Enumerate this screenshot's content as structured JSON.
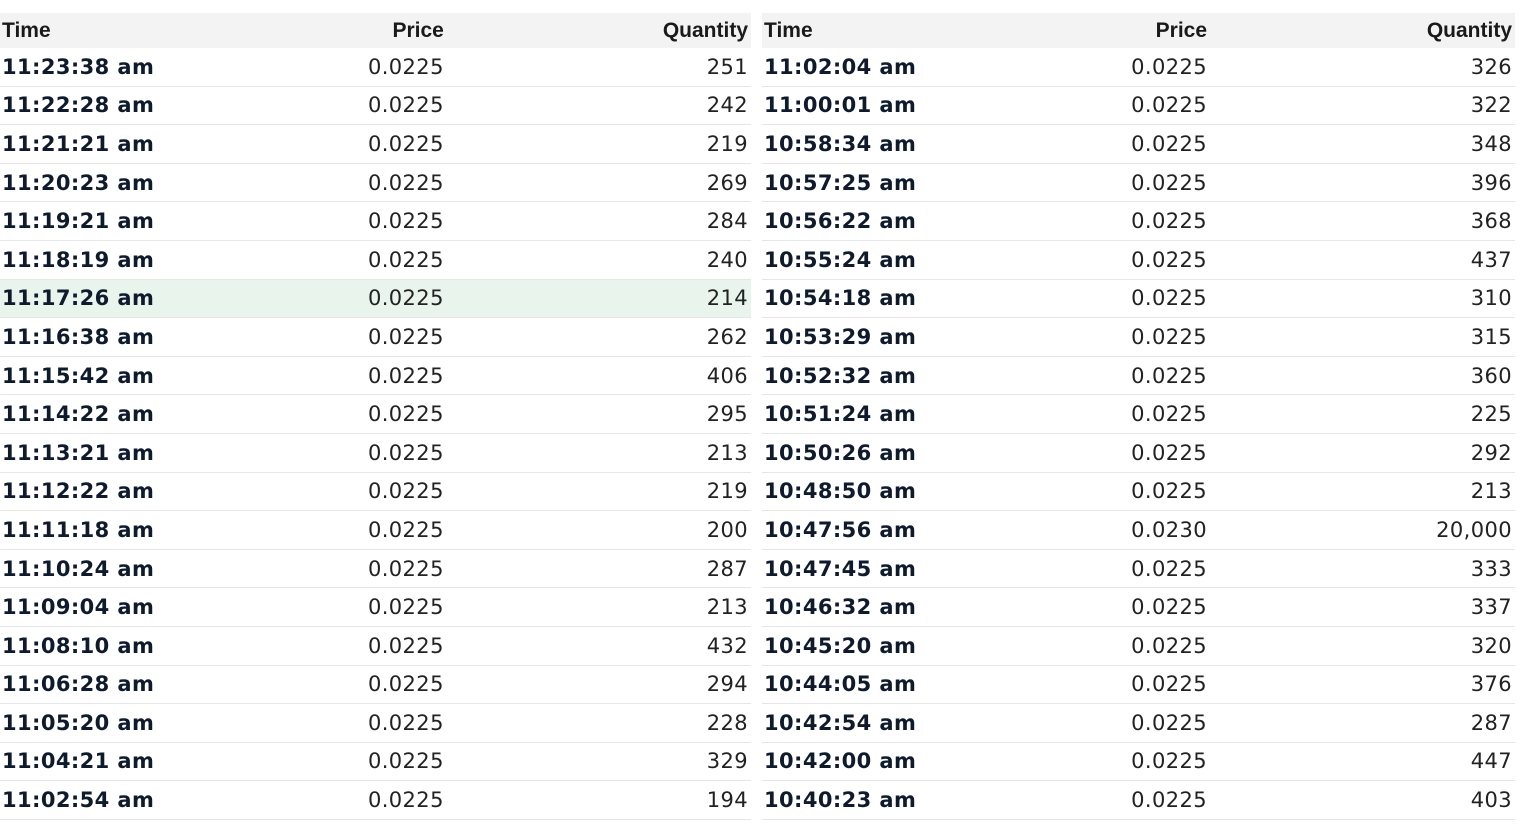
{
  "tables": [
    {
      "headers": {
        "time": "Time",
        "price": "Price",
        "quantity": "Quantity"
      },
      "rows": [
        {
          "time": "11:23:38 am",
          "price": "0.0225",
          "quantity": "251"
        },
        {
          "time": "11:22:28 am",
          "price": "0.0225",
          "quantity": "242"
        },
        {
          "time": "11:21:21 am",
          "price": "0.0225",
          "quantity": "219"
        },
        {
          "time": "11:20:23 am",
          "price": "0.0225",
          "quantity": "269"
        },
        {
          "time": "11:19:21 am",
          "price": "0.0225",
          "quantity": "284"
        },
        {
          "time": "11:18:19 am",
          "price": "0.0225",
          "quantity": "240"
        },
        {
          "time": "11:17:26 am",
          "price": "0.0225",
          "quantity": "214",
          "highlighted": true
        },
        {
          "time": "11:16:38 am",
          "price": "0.0225",
          "quantity": "262"
        },
        {
          "time": "11:15:42 am",
          "price": "0.0225",
          "quantity": "406"
        },
        {
          "time": "11:14:22 am",
          "price": "0.0225",
          "quantity": "295"
        },
        {
          "time": "11:13:21 am",
          "price": "0.0225",
          "quantity": "213"
        },
        {
          "time": "11:12:22 am",
          "price": "0.0225",
          "quantity": "219"
        },
        {
          "time": "11:11:18 am",
          "price": "0.0225",
          "quantity": "200"
        },
        {
          "time": "11:10:24 am",
          "price": "0.0225",
          "quantity": "287"
        },
        {
          "time": "11:09:04 am",
          "price": "0.0225",
          "quantity": "213"
        },
        {
          "time": "11:08:10 am",
          "price": "0.0225",
          "quantity": "432"
        },
        {
          "time": "11:06:28 am",
          "price": "0.0225",
          "quantity": "294"
        },
        {
          "time": "11:05:20 am",
          "price": "0.0225",
          "quantity": "228"
        },
        {
          "time": "11:04:21 am",
          "price": "0.0225",
          "quantity": "329"
        },
        {
          "time": "11:02:54 am",
          "price": "0.0225",
          "quantity": "194"
        }
      ]
    },
    {
      "headers": {
        "time": "Time",
        "price": "Price",
        "quantity": "Quantity"
      },
      "rows": [
        {
          "time": "11:02:04 am",
          "price": "0.0225",
          "quantity": "326"
        },
        {
          "time": "11:00:01 am",
          "price": "0.0225",
          "quantity": "322"
        },
        {
          "time": "10:58:34 am",
          "price": "0.0225",
          "quantity": "348"
        },
        {
          "time": "10:57:25 am",
          "price": "0.0225",
          "quantity": "396"
        },
        {
          "time": "10:56:22 am",
          "price": "0.0225",
          "quantity": "368"
        },
        {
          "time": "10:55:24 am",
          "price": "0.0225",
          "quantity": "437"
        },
        {
          "time": "10:54:18 am",
          "price": "0.0225",
          "quantity": "310"
        },
        {
          "time": "10:53:29 am",
          "price": "0.0225",
          "quantity": "315"
        },
        {
          "time": "10:52:32 am",
          "price": "0.0225",
          "quantity": "360"
        },
        {
          "time": "10:51:24 am",
          "price": "0.0225",
          "quantity": "225"
        },
        {
          "time": "10:50:26 am",
          "price": "0.0225",
          "quantity": "292"
        },
        {
          "time": "10:48:50 am",
          "price": "0.0225",
          "quantity": "213"
        },
        {
          "time": "10:47:56 am",
          "price": "0.0230",
          "quantity": "20,000"
        },
        {
          "time": "10:47:45 am",
          "price": "0.0225",
          "quantity": "333"
        },
        {
          "time": "10:46:32 am",
          "price": "0.0225",
          "quantity": "337"
        },
        {
          "time": "10:45:20 am",
          "price": "0.0225",
          "quantity": "320"
        },
        {
          "time": "10:44:05 am",
          "price": "0.0225",
          "quantity": "376"
        },
        {
          "time": "10:42:54 am",
          "price": "0.0225",
          "quantity": "287"
        },
        {
          "time": "10:42:00 am",
          "price": "0.0225",
          "quantity": "447"
        },
        {
          "time": "10:40:23 am",
          "price": "0.0225",
          "quantity": "403"
        }
      ]
    }
  ],
  "colors": {
    "header_bg": "#f3f3f3",
    "row_border": "#e6e6e6",
    "highlight_bg": "#e9f4ec",
    "time_text": "#0f1b2d"
  }
}
